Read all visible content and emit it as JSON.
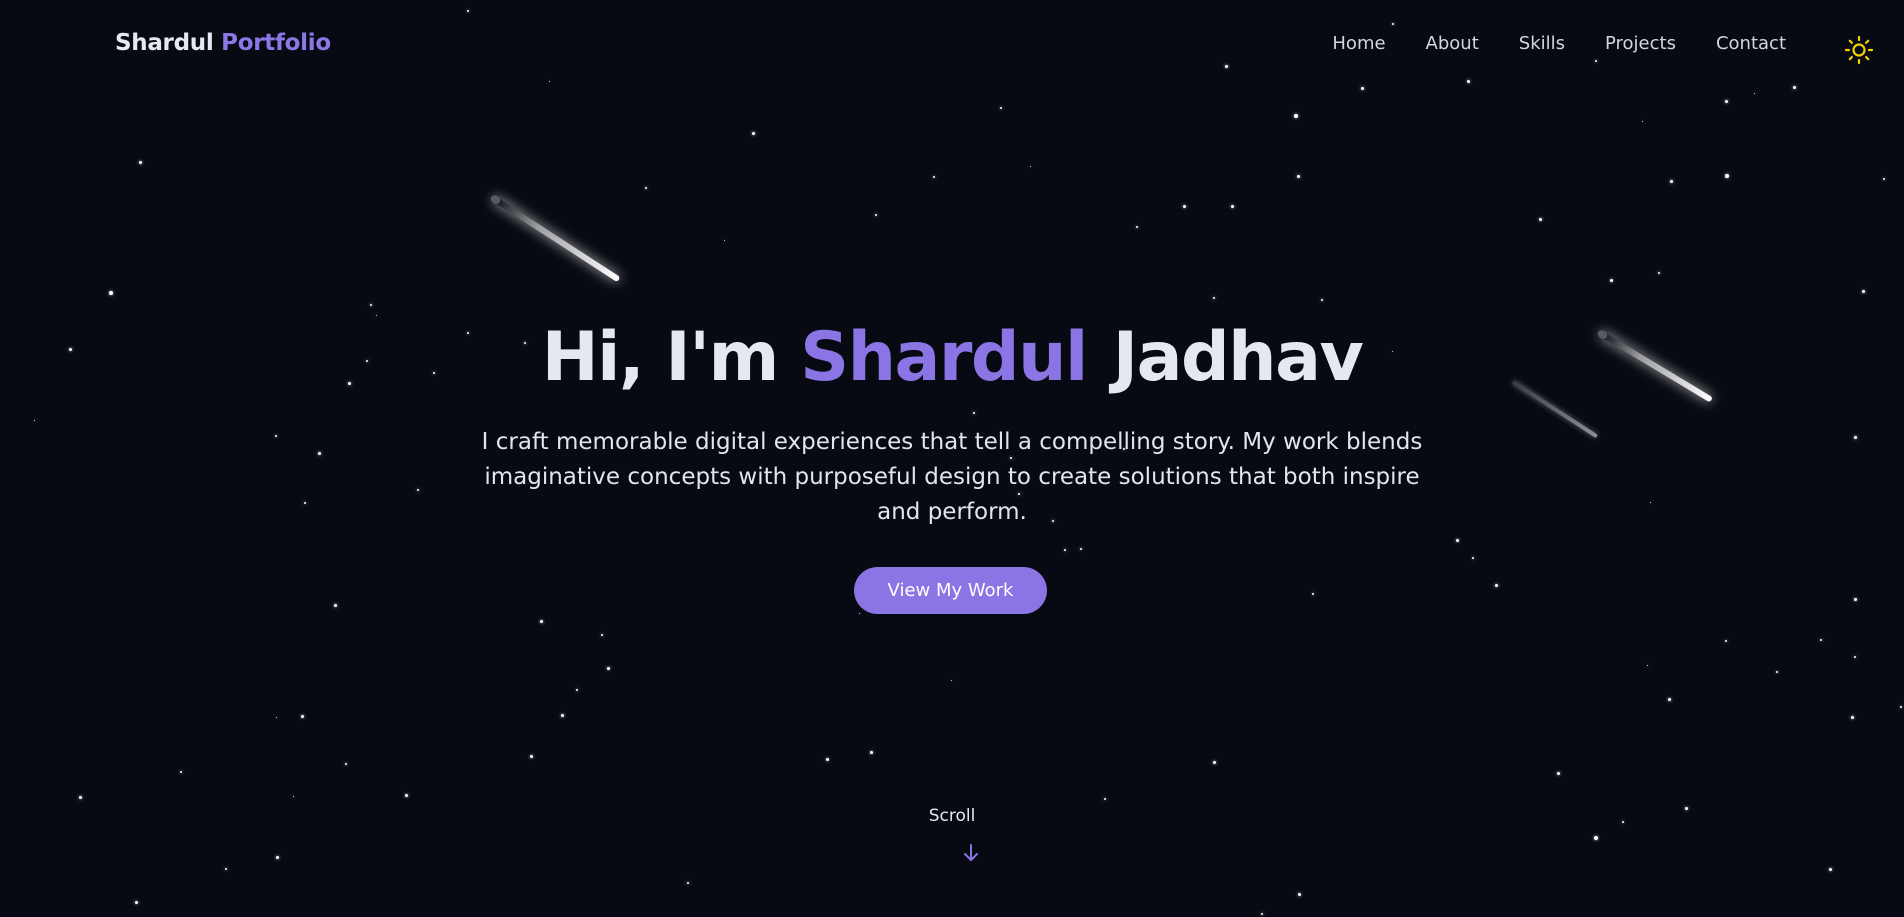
{
  "colors": {
    "background": "#070a12",
    "accent": "#8b74e3",
    "text": "#e4e8f1",
    "sun_icon": "#f5d000"
  },
  "header": {
    "logo_first": "Shardul",
    "logo_second": "Portfolio",
    "nav": [
      "Home",
      "About",
      "Skills",
      "Projects",
      "Contact"
    ],
    "theme_toggle_icon": "sun-icon"
  },
  "hero": {
    "greeting": "Hi, I'm",
    "first_name": "Shardul",
    "last_name": "Jadhav",
    "tagline": "I craft memorable digital experiences that tell a compelling story. My work blends imaginative concepts with purposeful design to create solutions that both inspire and perform.",
    "cta_label": "View My Work"
  },
  "scroll": {
    "label": "Scroll",
    "icon": "arrow-down-icon"
  }
}
